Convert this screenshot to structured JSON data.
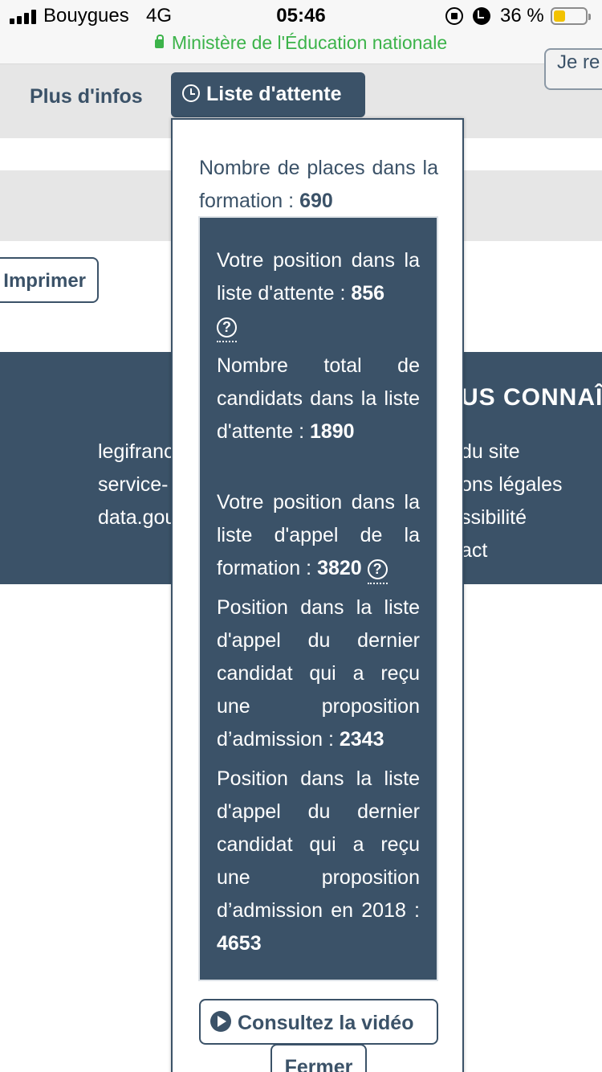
{
  "status_bar": {
    "carrier": "Bouygues",
    "network": "4G",
    "time": "05:46",
    "battery_percent": "36 %",
    "battery_level": 0.36,
    "url_title": "Ministère de l'Éducation nationale"
  },
  "background_page": {
    "tab_plus_infos": "Plus d'infos",
    "top_right_button": "Je re",
    "print_button": "Imprimer",
    "footer": {
      "title": "US CONNAÎ",
      "left_links": [
        "legifranc",
        "service-",
        "data.gou"
      ],
      "right_links": [
        "du site",
        "ons légales",
        "ssibilité",
        "act"
      ]
    }
  },
  "popover": {
    "tab_label": "Liste d'attente",
    "places_label": "Nombre de places dans la formation : ",
    "places_value": "690",
    "position_label": "Votre position dans la liste d'attente : ",
    "position_value": "856",
    "total_label": "Nombre total de candidats dans la liste d'attente : ",
    "total_value": "1890",
    "call_position_label": "Votre position dans la liste d'appel de la formation : ",
    "call_position_value": "3820",
    "last_admitted_label": "Position dans la liste d'appel du dernier candidat qui a reçu une proposition d’admission : ",
    "last_admitted_value": "2343",
    "last_admitted_2018_label": "Position dans la liste d'appel du dernier candidat qui a reçu une proposition d’admission en 2018 : ",
    "last_admitted_2018_value": "4653",
    "help_glyph": "?",
    "video_button": "Consultez la vidéo",
    "close_button": "Fermer"
  },
  "colors": {
    "primary": "#3b5268",
    "url_green": "#3cb34a",
    "battery": "#f2c200",
    "gray_band": "#e6e6e6"
  },
  "icons": [
    "signal-icon",
    "lock-rotation-icon",
    "alarm-icon",
    "battery-icon",
    "padlock-icon",
    "clock-icon",
    "help-icon",
    "play-icon"
  ]
}
